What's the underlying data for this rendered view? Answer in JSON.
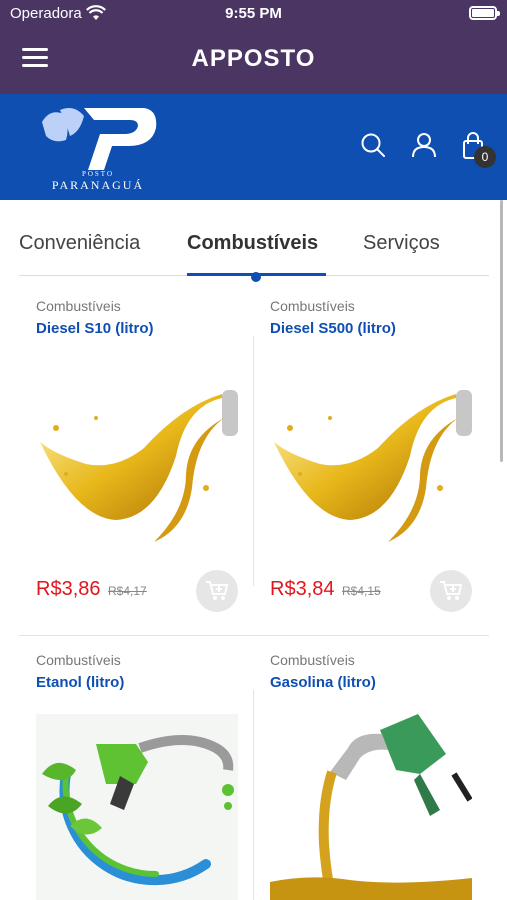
{
  "status_bar": {
    "carrier": "Operadora",
    "time": "9:55 PM"
  },
  "app": {
    "brand": "APPOSTO",
    "brand_color": "#4a3563"
  },
  "store": {
    "logo_line1": "POSTO",
    "logo_line2": "PARANAGUÁ",
    "cart_count": "0",
    "color": "#0f4fb2"
  },
  "tabs": [
    {
      "label": "Conveniência",
      "active": false
    },
    {
      "label": "Combustíveis",
      "active": true
    },
    {
      "label": "Serviços",
      "active": false
    }
  ],
  "products": [
    {
      "category": "Combustíveis",
      "name": "Diesel S10 (litro)",
      "price": "R$3,86",
      "old_price": "R$4,17",
      "image": "oil-pour-image"
    },
    {
      "category": "Combustíveis",
      "name": "Diesel S500 (litro)",
      "price": "R$3,84",
      "old_price": "R$4,15",
      "image": "oil-pour-image"
    },
    {
      "category": "Combustíveis",
      "name": "Etanol (litro)",
      "image": "ethanol-nozzle-image"
    },
    {
      "category": "Combustíveis",
      "name": "Gasolina (litro)",
      "image": "gasoline-nozzle-image"
    }
  ],
  "colors": {
    "price": "#e0161d",
    "link": "#0f4fb2"
  }
}
